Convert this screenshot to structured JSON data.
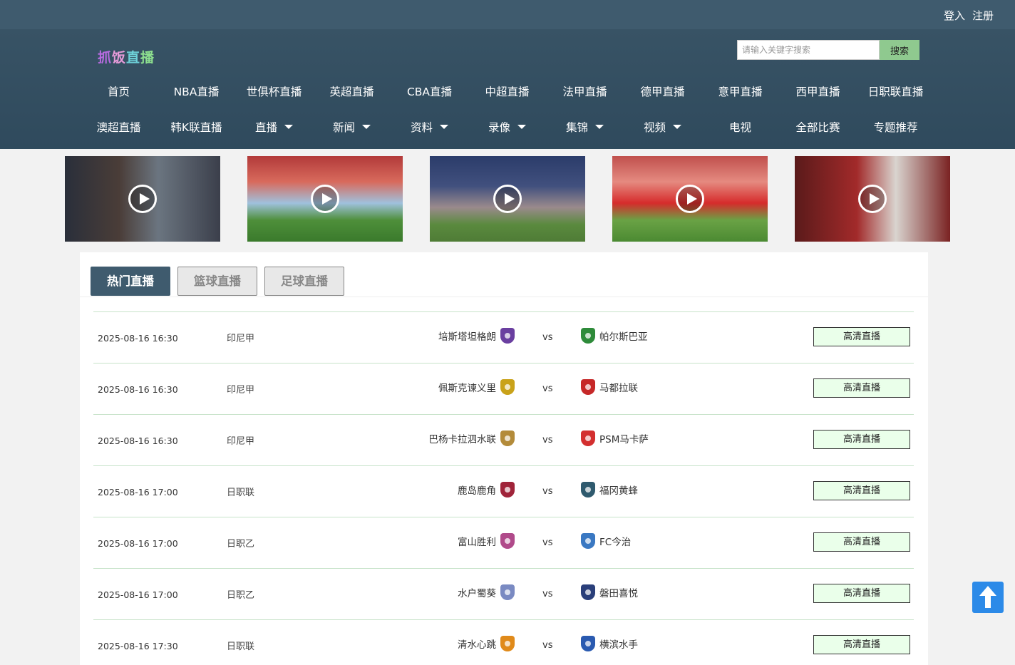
{
  "top_links": {
    "login": "登入",
    "register": "注册"
  },
  "logo": {
    "chars": [
      "抓",
      "饭",
      "直",
      "播"
    ]
  },
  "search": {
    "placeholder": "请输入关键字搜索",
    "button": "搜索"
  },
  "nav_row1": [
    "首页",
    "NBA直播",
    "世俱杯直播",
    "英超直播",
    "CBA直播",
    "中超直播",
    "法甲直播",
    "德甲直播",
    "意甲直播",
    "西甲直播",
    "日职联直播"
  ],
  "nav_row2": [
    {
      "label": "澳超直播",
      "dropdown": false
    },
    {
      "label": "韩K联直播",
      "dropdown": false
    },
    {
      "label": "直播",
      "dropdown": true
    },
    {
      "label": "新闻",
      "dropdown": true
    },
    {
      "label": "资料",
      "dropdown": true
    },
    {
      "label": "录像",
      "dropdown": true
    },
    {
      "label": "集锦",
      "dropdown": true
    },
    {
      "label": "视频",
      "dropdown": true
    },
    {
      "label": "电视",
      "dropdown": false
    },
    {
      "label": "全部比赛",
      "dropdown": false
    },
    {
      "label": "专题推荐",
      "dropdown": false
    }
  ],
  "tabs": [
    "热门直播",
    "篮球直播",
    "足球直播"
  ],
  "active_tab": 0,
  "matches": [
    {
      "time": "2025-08-16 16:30",
      "league": "印尼甲",
      "home": "培斯塔坦格朗",
      "vs": "vs",
      "away": "帕尔斯巴亚",
      "action": "高清直播",
      "home_color": "#6a3fa0",
      "away_color": "#2e8b3a"
    },
    {
      "time": "2025-08-16 16:30",
      "league": "印尼甲",
      "home": "佩斯克谏义里",
      "vs": "vs",
      "away": "马都拉联",
      "action": "高清直播",
      "home_color": "#c9a21a",
      "away_color": "#c62828"
    },
    {
      "time": "2025-08-16 16:30",
      "league": "印尼甲",
      "home": "巴杨卡拉泗水联",
      "vs": "vs",
      "away": "PSM马卡萨",
      "action": "高清直播",
      "home_color": "#b38b3a",
      "away_color": "#d32f2f"
    },
    {
      "time": "2025-08-16 17:00",
      "league": "日职联",
      "home": "鹿岛鹿角",
      "vs": "vs",
      "away": "福冈黄蜂",
      "action": "高清直播",
      "home_color": "#a0243a",
      "away_color": "#2f5a6e"
    },
    {
      "time": "2025-08-16 17:00",
      "league": "日职乙",
      "home": "富山胜利",
      "vs": "vs",
      "away": "FC今治",
      "action": "高清直播",
      "home_color": "#b04a8a",
      "away_color": "#3a78c2"
    },
    {
      "time": "2025-08-16 17:00",
      "league": "日职乙",
      "home": "水户蜀葵",
      "vs": "vs",
      "away": "磐田喜悦",
      "action": "高清直播",
      "home_color": "#7a8ac2",
      "away_color": "#2a3f7a"
    },
    {
      "time": "2025-08-16 17:30",
      "league": "日职联",
      "home": "清水心跳",
      "vs": "vs",
      "away": "横滨水手",
      "action": "高清直播",
      "home_color": "#e08a1a",
      "away_color": "#2a5ab0"
    }
  ]
}
